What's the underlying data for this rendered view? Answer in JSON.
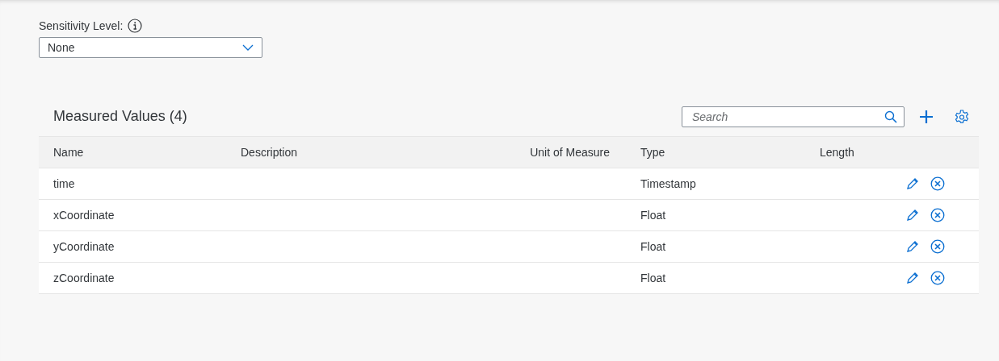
{
  "sensitivity": {
    "label": "Sensitivity Level:",
    "value": "None"
  },
  "table": {
    "title": "Measured Values (4)",
    "search": {
      "placeholder": "Search"
    },
    "columns": [
      "Name",
      "Description",
      "Unit of Measure",
      "Type",
      "Length"
    ],
    "rows": [
      {
        "name": "time",
        "description": "",
        "unit": "",
        "type": "Timestamp",
        "length": ""
      },
      {
        "name": "xCoordinate",
        "description": "",
        "unit": "",
        "type": "Float",
        "length": ""
      },
      {
        "name": "yCoordinate",
        "description": "",
        "unit": "",
        "type": "Float",
        "length": ""
      },
      {
        "name": "zCoordinate",
        "description": "",
        "unit": "",
        "type": "Float",
        "length": ""
      }
    ]
  }
}
